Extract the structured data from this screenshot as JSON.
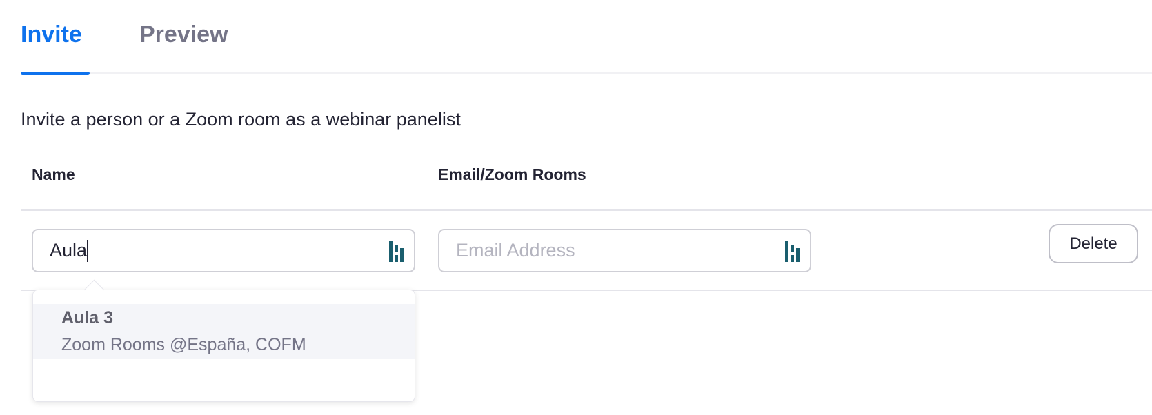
{
  "tabs": [
    {
      "label": "Invite",
      "active": true
    },
    {
      "label": "Preview",
      "active": false
    }
  ],
  "description": "Invite a person or a Zoom room as a webinar panelist",
  "table": {
    "columns": [
      "Name",
      "Email/Zoom Rooms"
    ]
  },
  "row": {
    "name_value": "Aula",
    "email_placeholder": "Email Address",
    "delete_label": "Delete"
  },
  "suggestions": [
    {
      "title": "Aula 3",
      "subtitle": "Zoom Rooms @España, COFM"
    }
  ],
  "colors": {
    "accent": "#0e72ed",
    "password_manager_icon": "#1a5e6e"
  },
  "icons": {
    "field_icon": "password-manager-icon"
  }
}
